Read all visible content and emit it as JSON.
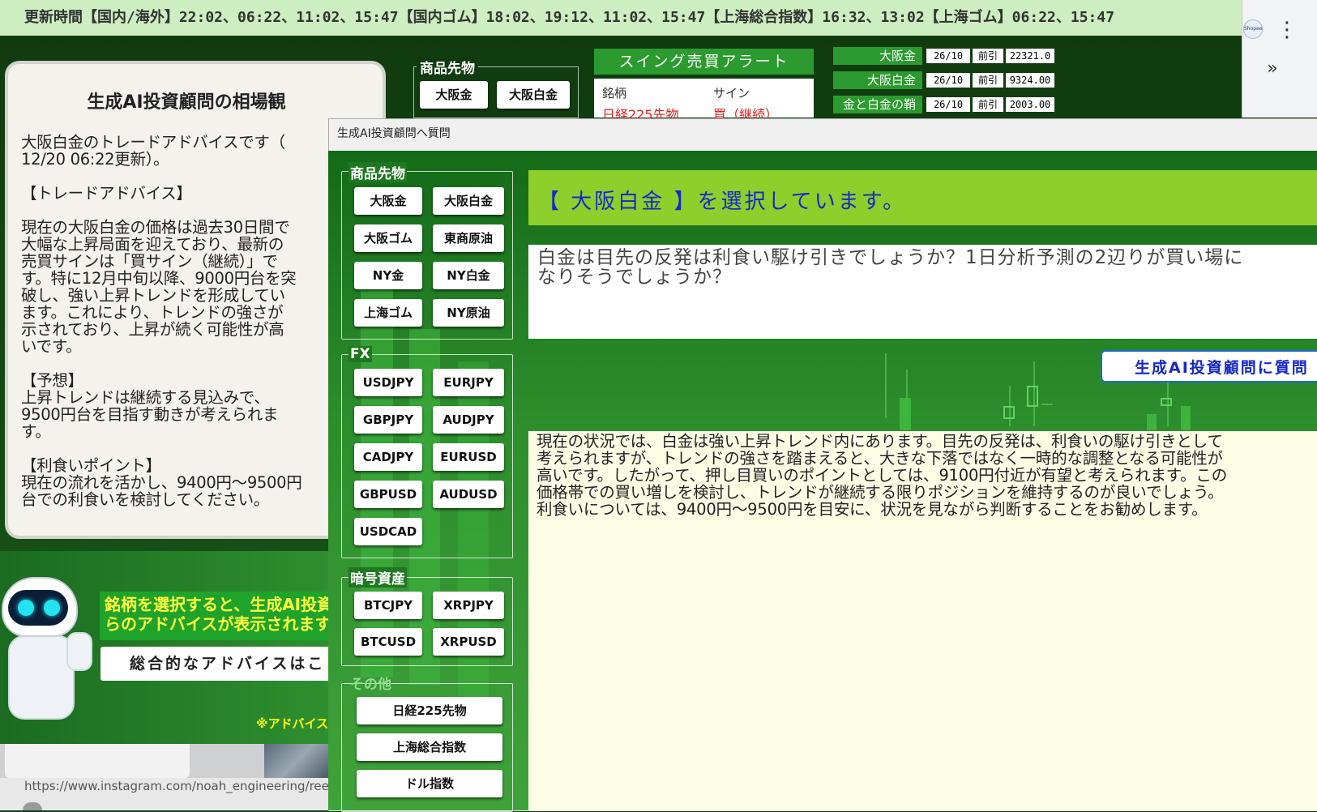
{
  "update_bar": {
    "text": "更新時間【国内/海外】22:02、06:22、11:02、15:47【国内ゴム】18:02、19:12、11:02、15:47【上海総合指数】16:32、13:02【上海ゴム】06:22、15:47"
  },
  "browser": {
    "logo_text": "Shopee",
    "menu_icon": "⋮",
    "overflow_icon": "»"
  },
  "background": {
    "commodity_group_title": "商品先物",
    "buttons": [
      "大阪金",
      "大阪白金"
    ],
    "swing": {
      "title": "スイング売買アラート",
      "col_symbol": "銘柄",
      "col_sign": "サイン",
      "row_symbol": "日経225先物",
      "row_sign": "買（継続）"
    },
    "prices": [
      {
        "label": "大阪金",
        "date": "26/10",
        "type": "前引",
        "value": "22321.0"
      },
      {
        "label": "大阪白金",
        "date": "26/10",
        "type": "前引",
        "value": "9324.00"
      },
      {
        "label": "金と白金の鞘",
        "date": "26/10",
        "type": "前引",
        "value": "2003.00"
      }
    ]
  },
  "advice_card": {
    "title": "生成AI投資顧問の相場観",
    "text": "大阪白金のトレードアドバイスです（\n12/20 06:22更新）。\n\n【トレードアドバイス】\n\n現在の大阪白金の価格は過去30日間で\n大幅な上昇局面を迎えており、最新の\n売買サインは「買サイン（継続）」で\nす。特に12月中旬以降、9000円台を突\n破し、強い上昇トレンドを形成してい\nます。これにより、トレンドの強さが\n示されており、上昇が続く可能性が高\nいです。\n\n【予想】\n上昇トレンドは継続する見込みで、\n9500円台を目指す動きが考えられま\nす。\n\n【利食いポイント】\n現在の流れを活かし、9400円～9500円\n台での利食いを検討してください。"
  },
  "left_lower": {
    "hint": "銘柄を選択すると、生成AI投資\nらのアドバイスが表示されます。",
    "overall_button": "総合的なアドバイスはこ",
    "note": "※アドバイスの",
    "url": "https://www.instagram.com/noah_engineering/reel/"
  },
  "dialog": {
    "title": "生成AI投資顧問へ質問",
    "groups": [
      {
        "title": "商品先物",
        "buttons": [
          "大阪金",
          "大阪白金",
          "大阪ゴム",
          "東商原油",
          "NY金",
          "NY白金",
          "上海ゴム",
          "NY原油"
        ]
      },
      {
        "title": "FX",
        "buttons": [
          "USDJPY",
          "EURJPY",
          "GBPJPY",
          "AUDJPY",
          "CADJPY",
          "EURUSD",
          "GBPUSD",
          "AUDUSD",
          "USDCAD"
        ]
      },
      {
        "title": "暗号資産",
        "buttons": [
          "BTCJPY",
          "XRPJPY",
          "BTCUSD",
          "XRPUSD"
        ]
      },
      {
        "title": "その他",
        "buttons": [
          "日経225先物",
          "上海総合指数",
          "ドル指数"
        ]
      }
    ],
    "selected_text": "【 大阪白金 】を選択しています。",
    "question": "白金は目先の反発は利食い駆け引きでしょうか？1日分析予測の2辺りが買い場に\nなりそうでしょうか？",
    "ask_button": "生成AI投資顧問に質問",
    "answer": "現在の状況では、白金は強い上昇トレンド内にあります。目先の反発は、利食いの駆け引きとして\n考えられますが、トレンドの強さを踏まえると、大きな下落ではなく一時的な調整となる可能性が\n高いです。したがって、押し目買いのポイントとしては、9100円付近が有望と考えられます。この\n価格帯での買い増しを検討し、トレンドが継続する限りポジションを維持するのが良いでしょう。\n利食いについては、9400円～9500円を目安に、状況を見ながら判断することをお勧めします。"
  }
}
